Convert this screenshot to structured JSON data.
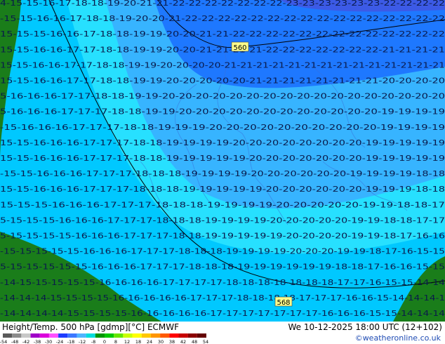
{
  "footer": {
    "title_left": "Height/Temp. 500 hPa [gdmp][°C] ECMWF",
    "title_right": "We 10-12-2025 18:00 UTC (12+102)",
    "credit": "©weatheronline.co.uk"
  },
  "colors": {
    "land": "#1a7d1a",
    "sea": "#00c8ff",
    "band_lt": "#27e0ff",
    "band_mid": "#37b4ff",
    "band_deep": "#1e78ff",
    "band_dark": "#3c5ae6"
  },
  "contours": {
    "height_labels": [
      "560",
      "568"
    ]
  },
  "temperature_rows": [
    "4-15-15-16-17-18-18-19-20-21-21-22-22-22-22-22-22-22-23-23-23-23-23-23-22-22-22-22",
    "-15-15-16-16-17-18-18-19-20-20-21-22-22-22-22-22-22-22-22-22-22-22-22-22-22-22-22",
    "15-15-15-16-16-17-18-18-19-19-20-20-21-21-22-22-22-22-22-22-22-22-22-22-22-22-22",
    "15-15-16-16-17-17-18-18-19-19-20-20-21-21-21-21-22-22-22-22-22-22-22-21-21-21-21",
    "15-15-16-16-17-17-18-18-19-19-20-20-20-20-21-21-21-21-21-21-21-21-21-21-21-21-21-21",
    "15-15-16-16-17-17-18-18-19-19-20-20-20-20-20-21-21-21-21-21-21-21-21-20-20-20-20",
    "5-16-16-16-17-17-18-18-19-19-20-20-20-20-20-20-20-20-20-20-20-20-20-20-20-20-20",
    "5-16-16-16-17-17-17-18-18-19-19-20-20-20-20-20-20-20-20-20-20-20-20-19-19-19-19",
    "-15-16-16-16-17-17-17-18-18-19-19-19-20-20-20-20-20-20-20-20-20-20-19-19-19-19",
    "15-15-16-16-16-17-17-17-18-18-19-19-19-19-20-20-20-20-20-20-20-20-19-19-19-19-19",
    "15-15-16-16-16-17-17-17-18-18-19-19-19-19-19-20-20-20-20-20-20-20-19-19-19-19-19",
    "-15-15-16-16-16-17-17-17-18-18-18-19-19-19-19-20-20-20-20-20-20-19-19-19-19-18-18",
    "15-15-16-16-16-17-17-17-18-18-18-19-19-19-19-19-20-20-20-20-20-20-19-19-19-18-18",
    "15-15-15-16-16-16-17-17-17-18-18-18-19-19-19-19-20-20-20-20-20-19-19-18-18-17",
    "5-15-15-15-16-16-16-17-17-17-18-18-18-19-19-19-19-20-20-20-20-20-19-19-18-18-17-17",
    "5-15-15-15-15-16-16-16-17-17-17-18-18-19-19-19-19-19-20-20-20-20-19-19-18-17-16-16",
    "-15-15-15-15-15-16-16-16-17-17-17-18-18-18-19-19-19-19-20-20-20-19-19-18-17-16-15-15",
    "5-15-15-15-15-15-16-16-16-17-17-17-18-18-18-19-19-19-19-19-19-18-18-17-16-16-15-15",
    "-14-15-15-15-15-15-16-16-16-16-17-17-17-17-18-18-18-18-18-18-18-17-17-16-15-15-14-14",
    "-14-14-14-15-15-15-15-16-16-16-16-16-17-17-17-18-18-18-18-17-17-17-16-16-15-14-14-14-1",
    "-14-14-14-14-15-15-15-15-16-16-16-16-16-17-17-17-17-17-17-17-16-16-16-15-15-14-14-14"
  ],
  "legend": {
    "colors": [
      "#5a5a5a",
      "#8c8c8c",
      "#c8c8c8",
      "#a000c8",
      "#dc00dc",
      "#ff50ff",
      "#1e3cff",
      "#3c78ff",
      "#50b4ff",
      "#00dcdc",
      "#009600",
      "#00c800",
      "#64e600",
      "#c8ff00",
      "#ffff00",
      "#ffc800",
      "#ff9600",
      "#ff5a00",
      "#ff0000",
      "#c80000",
      "#8c0000",
      "#640000"
    ],
    "labels": [
      "-54",
      "-48",
      "-42",
      "-38",
      "-30",
      "-24",
      "-18",
      "-12",
      "-8",
      "0",
      "8",
      "12",
      "18",
      "24",
      "30",
      "38",
      "42",
      "48",
      "54"
    ]
  }
}
